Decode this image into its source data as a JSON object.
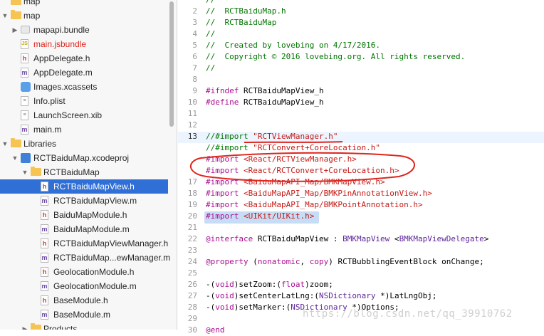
{
  "navigator": {
    "items": [
      {
        "label": "map",
        "kind": "root",
        "indent": 0
      },
      {
        "label": "map",
        "kind": "folder",
        "indent": 0,
        "open": true
      },
      {
        "label": "mapapi.bundle",
        "kind": "bundle",
        "indent": 1,
        "closed": true
      },
      {
        "label": "main.jsbundle",
        "kind": "js",
        "indent": 1,
        "red": true
      },
      {
        "label": "AppDelegate.h",
        "kind": "h",
        "indent": 1
      },
      {
        "label": "AppDelegate.m",
        "kind": "m",
        "indent": 1
      },
      {
        "label": "Images.xcassets",
        "kind": "assets",
        "indent": 1
      },
      {
        "label": "Info.plist",
        "kind": "plist",
        "indent": 1
      },
      {
        "label": "LaunchScreen.xib",
        "kind": "xib",
        "indent": 1
      },
      {
        "label": "main.m",
        "kind": "m",
        "indent": 1
      },
      {
        "label": "Libraries",
        "kind": "folder",
        "indent": 0,
        "open": true
      },
      {
        "label": "RCTBaiduMap.xcodeproj",
        "kind": "proj",
        "indent": 1,
        "open": true
      },
      {
        "label": "RCTBaiduMap",
        "kind": "folder",
        "indent": 2,
        "open": true
      },
      {
        "label": "RCTBaiduMapView.h",
        "kind": "h",
        "indent": 3,
        "selected": true
      },
      {
        "label": "RCTBaiduMapView.m",
        "kind": "m",
        "indent": 3
      },
      {
        "label": "BaiduMapModule.h",
        "kind": "h",
        "indent": 3
      },
      {
        "label": "BaiduMapModule.m",
        "kind": "m",
        "indent": 3
      },
      {
        "label": "RCTBaiduMapViewManager.h",
        "kind": "h",
        "indent": 3
      },
      {
        "label": "RCTBaiduMap...ewManager.m",
        "kind": "m",
        "indent": 3
      },
      {
        "label": "GeolocationModule.h",
        "kind": "h",
        "indent": 3
      },
      {
        "label": "GeolocationModule.m",
        "kind": "m",
        "indent": 3
      },
      {
        "label": "BaseModule.h",
        "kind": "h",
        "indent": 3
      },
      {
        "label": "BaseModule.m",
        "kind": "m",
        "indent": 3
      },
      {
        "label": "Products",
        "kind": "folder",
        "indent": 2,
        "closed": true
      }
    ]
  },
  "editor": {
    "current_line": "13",
    "lines": [
      {
        "n": "",
        "t": [
          [
            "c",
            "//"
          ]
        ]
      },
      {
        "n": "2",
        "t": [
          [
            "c",
            "//  RCTBaiduMap.h"
          ]
        ]
      },
      {
        "n": "3",
        "t": [
          [
            "c",
            "//  RCTBaiduMap"
          ]
        ]
      },
      {
        "n": "4",
        "t": [
          [
            "c",
            "//"
          ]
        ]
      },
      {
        "n": "5",
        "t": [
          [
            "c",
            "//  Created by lovebing on 4/17/2016."
          ]
        ]
      },
      {
        "n": "6",
        "t": [
          [
            "c",
            "//  Copyright © 2016 lovebing.org. All rights reserved."
          ]
        ]
      },
      {
        "n": "7",
        "t": [
          [
            "c",
            "//"
          ]
        ]
      },
      {
        "n": "8",
        "t": []
      },
      {
        "n": "9",
        "t": [
          [
            "kw",
            "#ifndef"
          ],
          [
            "",
            " RCTBaiduMapView_h"
          ]
        ]
      },
      {
        "n": "10",
        "t": [
          [
            "kw",
            "#define"
          ],
          [
            "",
            " RCTBaiduMapView_h"
          ]
        ]
      },
      {
        "n": "11",
        "t": []
      },
      {
        "n": "12",
        "t": []
      },
      {
        "n": "13",
        "t": [
          [
            "c",
            "//#import "
          ],
          [
            "str",
            "\"RCTViewManager.h\""
          ]
        ]
      },
      {
        "n": "",
        "t": [
          [
            "c",
            "//#import "
          ],
          [
            "str",
            "\"RCTConvert+CoreLocation.h\""
          ]
        ]
      },
      {
        "n": "",
        "t": [
          [
            "kw",
            "#import"
          ],
          [
            "",
            " "
          ],
          [
            "str",
            "<React/RCTViewManager.h>"
          ]
        ]
      },
      {
        "n": "",
        "t": [
          [
            "kw",
            "#import"
          ],
          [
            "",
            " "
          ],
          [
            "str",
            "<React/RCTConvert+CoreLocation.h>"
          ]
        ]
      },
      {
        "n": "17",
        "t": [
          [
            "kw",
            "#import"
          ],
          [
            "",
            " "
          ],
          [
            "str",
            "<BaiduMapAPI_Map/BMKMapView.h>"
          ]
        ]
      },
      {
        "n": "18",
        "t": [
          [
            "kw",
            "#import"
          ],
          [
            "",
            " "
          ],
          [
            "str",
            "<BaiduMapAPI_Map/BMKPinAnnotationView.h>"
          ]
        ]
      },
      {
        "n": "19",
        "t": [
          [
            "kw",
            "#import"
          ],
          [
            "",
            " "
          ],
          [
            "str",
            "<BaiduMapAPI_Map/BMKPointAnnotation.h>"
          ]
        ]
      },
      {
        "n": "20",
        "t": [
          [
            "kw",
            "#import"
          ],
          [
            "",
            " "
          ],
          [
            "str",
            "<UIKit/UIKit.h>"
          ]
        ]
      },
      {
        "n": "21",
        "t": []
      },
      {
        "n": "22",
        "t": [
          [
            "kw",
            "@interface"
          ],
          [
            "",
            " RCTBaiduMapView : "
          ],
          [
            "cls",
            "BMKMapView"
          ],
          [
            "",
            " <"
          ],
          [
            "cls",
            "BMKMapViewDelegate"
          ],
          [
            "",
            ">"
          ]
        ]
      },
      {
        "n": "23",
        "t": []
      },
      {
        "n": "24",
        "t": [
          [
            "kw",
            "@property"
          ],
          [
            "",
            " ("
          ],
          [
            "kw",
            "nonatomic"
          ],
          [
            "",
            ", "
          ],
          [
            "kw",
            "copy"
          ],
          [
            "",
            ") RCTBubblingEventBlock onChange;"
          ]
        ]
      },
      {
        "n": "25",
        "t": []
      },
      {
        "n": "26",
        "t": [
          [
            "",
            "-("
          ],
          [
            "kw",
            "void"
          ],
          [
            "",
            ")setZoom:("
          ],
          [
            "kw",
            "float"
          ],
          [
            "",
            ")zoom;"
          ]
        ]
      },
      {
        "n": "27",
        "t": [
          [
            "",
            "-("
          ],
          [
            "kw",
            "void"
          ],
          [
            "",
            ")setCenterLatLng:("
          ],
          [
            "cls",
            "NSDictionary"
          ],
          [
            "",
            " *)LatLngObj;"
          ]
        ]
      },
      {
        "n": "28",
        "t": [
          [
            "",
            "-("
          ],
          [
            "kw",
            "void"
          ],
          [
            "",
            ")setMarker:("
          ],
          [
            "cls",
            "NSDictionary"
          ],
          [
            "",
            " *)Options;"
          ]
        ]
      },
      {
        "n": "29",
        "t": []
      },
      {
        "n": "30",
        "t": [
          [
            "kw",
            "@end"
          ]
        ]
      }
    ]
  },
  "watermark": "https://blog.csdn.net/qq_39910762",
  "colors": {
    "selection": "#2f6fd6",
    "annotation": "#e0241c",
    "comment": "#007400",
    "keyword": "#aa0d91",
    "string": "#c41a16"
  }
}
